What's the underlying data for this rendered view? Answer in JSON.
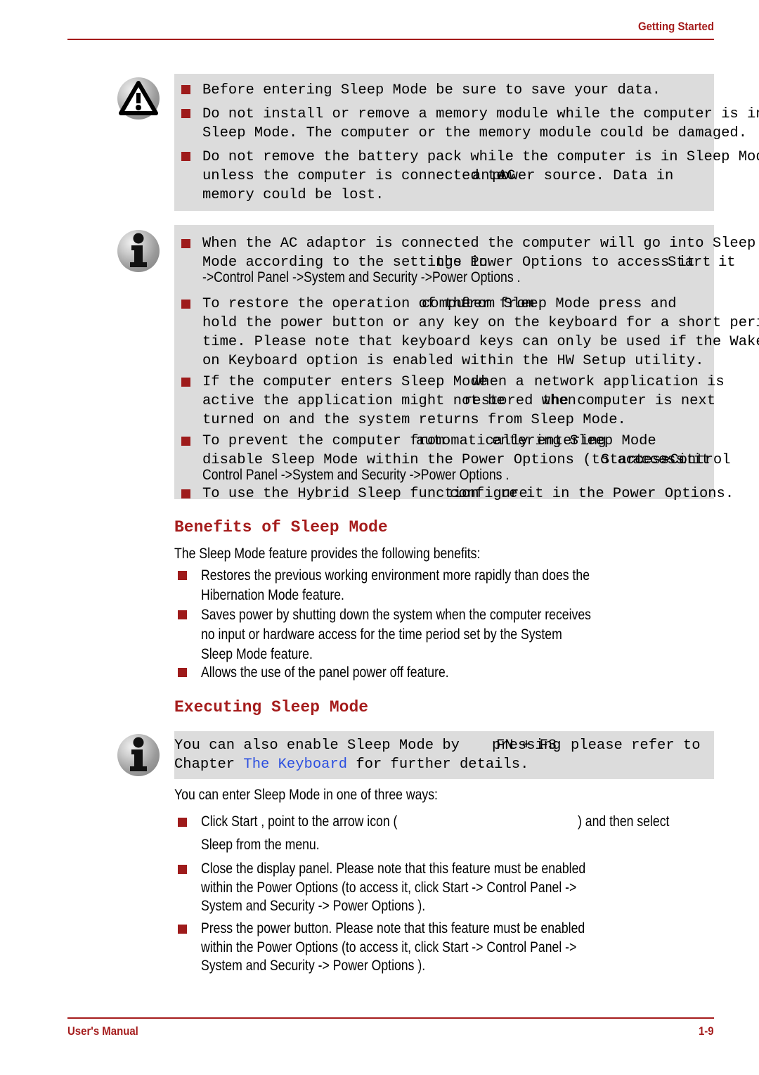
{
  "header": {
    "title": "Getting Started"
  },
  "footer": {
    "left": "User's Manual",
    "page": "1-9"
  },
  "colors": {
    "accent": "#A51C1C",
    "bullet": "#9E1B1B",
    "note_bg": "#DCDCDC",
    "link": "#2B4FE0"
  },
  "caution_box": {
    "icon": "warning-triangle-icon",
    "bullets": [
      {
        "lines": [
          "Before entering Sleep Mode be sure to save your data."
        ]
      },
      {
        "lines": [
          "Do not install or remove a memory module while the computer is in",
          "Sleep Mode. The computer or the memory module could be damaged."
        ]
      },
      {
        "lines": [
          "Do not remove the battery pack while the computer is in Sleep Mode",
          "unless the computer is connected to an AC power source. Data in",
          "memory could be lost."
        ],
        "overlap_on_line": 2,
        "overlap_text": "an AC",
        "overlap_base": "connected to"
      }
    ]
  },
  "info_box": {
    "icon": "info-i-icon",
    "bullets": [
      {
        "lines": [
          "When the AC adaptor is connected the computer will go into Sleep",
          "Mode according to the settings in the Power Options to access it",
          "->Control Panel ->System and Security ->Power Options ."
        ],
        "overlaps": [
          {
            "base": "settings in",
            "over": "the Power"
          },
          {
            "base": "access it",
            "over": "Start"
          }
        ],
        "path_line": "->Control Panel ->System and Security ->Power Options ."
      },
      {
        "lines": [
          "To restore the operation of the computer from Sleep Mode press and",
          "hold the power button or any key on the keyboard for a short period of",
          "time. Please note that keyboard keys can only be used if the Wake-up",
          "on Keyboard option is enabled within the HW Setup utility."
        ],
        "overlaps": [
          {
            "base": "of the computer",
            "over": "from"
          }
        ]
      },
      {
        "lines": [
          "If the computer enters Sleep Mode when a network application is",
          "active the application might not be restored when the computer is next",
          "turned on and the system returns from Sleep Mode."
        ],
        "overlaps": [
          {
            "base": "Sleep Mode",
            "over": "when a"
          },
          {
            "base": "might not be",
            "over": "restored when"
          }
        ]
      },
      {
        "lines": [
          "To prevent the computer from automatically entering Sleep Mode",
          "disable Sleep Mode within the Power Options (to access it, click Start ->",
          "Control Panel ->System and Security ->Power Options ."
        ],
        "overlaps": [
          {
            "base": "from automatically",
            "over": "entering"
          },
          {
            "base": "(to access it",
            "over": "Start"
          }
        ]
      },
      {
        "lines": [
          "To use the Hybrid Sleep function configure it in the Power Options."
        ],
        "overlaps": [
          {
            "base": "function",
            "over": "configure"
          }
        ]
      }
    ]
  },
  "section_benefits": {
    "heading": "Benefits of Sleep Mode",
    "intro": "The Sleep Mode feature provides the following benefits:",
    "bullets": [
      [
        "Restores the previous working environment more rapidly than does the",
        "Hibernation Mode feature."
      ],
      [
        "Saves power by shutting down the system when the computer receives",
        "no input or hardware access for the time period set by the System",
        "Sleep Mode feature."
      ],
      [
        "Allows the use of the panel power off feature."
      ]
    ]
  },
  "section_executing": {
    "heading": "Executing Sleep Mode",
    "note": {
      "icon": "info-i-icon",
      "line1_base": "You can also enable Sleep Mode by pressing please refer to",
      "line1_prefix": "You can also enable Sleep Mode by ",
      "line1_overlap_base": "pressing",
      "line1_overlap_over": "FN + F3",
      "line1_suffix": " please refer to",
      "line2_pre": "Chapter ",
      "line2_link": "The Keyboard",
      "line2_post": " for further details."
    },
    "intro": "You can enter Sleep Mode in one of three ways:",
    "bullets": [
      [
        "Click Start , point to the arrow icon (",
        ") and then select",
        "Sleep  from the menu."
      ],
      [
        "Close the display panel. Please note that this feature must be enabled",
        "within the Power Options (to access it, click Start -> Control Panel  ->",
        "System and Security   -> Power Options  )."
      ],
      [
        "Press the power button. Please note that this feature must be enabled",
        "within the Power Options (to access it, click Start -> Control Panel  ->",
        "System and Security   -> Power Options  )."
      ]
    ]
  }
}
